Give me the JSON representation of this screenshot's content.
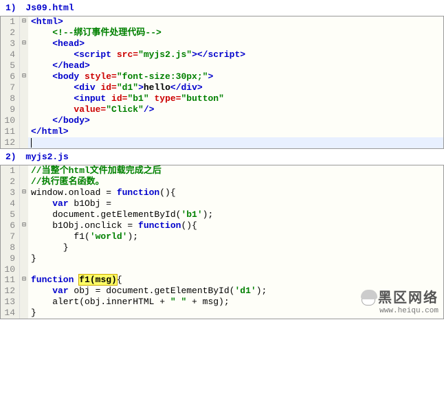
{
  "file1": {
    "num": "1)",
    "name": "Js09.html"
  },
  "file2": {
    "num": "2)",
    "name": "myjs2.js"
  },
  "editor1": {
    "lines": [
      {
        "n": "1",
        "fold": "⊟",
        "tokens": [
          [
            "t-tag",
            "<html>"
          ]
        ]
      },
      {
        "n": "2",
        "fold": "",
        "tokens": [
          [
            "t-plain",
            "    "
          ],
          [
            "t-comment",
            "<!--绑订事件处理代码-->"
          ]
        ]
      },
      {
        "n": "3",
        "fold": "⊟",
        "tokens": [
          [
            "t-plain",
            "    "
          ],
          [
            "t-tag",
            "<head>"
          ]
        ]
      },
      {
        "n": "4",
        "fold": "",
        "tokens": [
          [
            "t-plain",
            "        "
          ],
          [
            "t-tag",
            "<script "
          ],
          [
            "t-attr",
            "src="
          ],
          [
            "t-str",
            "\"myjs2.js\""
          ],
          [
            "t-tag",
            "></script"
          ],
          [
            "t-tag",
            ">"
          ]
        ]
      },
      {
        "n": "5",
        "fold": "",
        "tokens": [
          [
            "t-plain",
            "    "
          ],
          [
            "t-tag",
            "</head>"
          ]
        ]
      },
      {
        "n": "6",
        "fold": "⊟",
        "tokens": [
          [
            "t-plain",
            "    "
          ],
          [
            "t-tag",
            "<body "
          ],
          [
            "t-attr",
            "style="
          ],
          [
            "t-str",
            "\"font-size:30px;\""
          ],
          [
            "t-tag",
            ">"
          ]
        ]
      },
      {
        "n": "7",
        "fold": "",
        "tokens": [
          [
            "t-plain",
            "        "
          ],
          [
            "t-tag",
            "<div "
          ],
          [
            "t-attr",
            "id="
          ],
          [
            "t-str",
            "\"d1\""
          ],
          [
            "t-tag",
            ">"
          ],
          [
            "t-text",
            "hello"
          ],
          [
            "t-tag",
            "</div>"
          ]
        ]
      },
      {
        "n": "8",
        "fold": "",
        "tokens": [
          [
            "t-plain",
            "        "
          ],
          [
            "t-tag",
            "<input "
          ],
          [
            "t-attr",
            "id="
          ],
          [
            "t-str",
            "\"b1\""
          ],
          [
            "t-tag",
            " "
          ],
          [
            "t-attr",
            "type="
          ],
          [
            "t-str",
            "\"button\""
          ]
        ]
      },
      {
        "n": "9",
        "fold": "",
        "tokens": [
          [
            "t-plain",
            "        "
          ],
          [
            "t-attr",
            "value="
          ],
          [
            "t-str",
            "\"Click\""
          ],
          [
            "t-tag",
            "/>"
          ]
        ]
      },
      {
        "n": "10",
        "fold": "",
        "tokens": [
          [
            "t-plain",
            "    "
          ],
          [
            "t-tag",
            "</body>"
          ]
        ]
      },
      {
        "n": "11",
        "fold": "",
        "tokens": [
          [
            "t-tag",
            "</html>"
          ]
        ]
      },
      {
        "n": "12",
        "fold": "",
        "cursor": true,
        "tokens": []
      }
    ]
  },
  "editor2": {
    "lines": [
      {
        "n": "1",
        "fold": "",
        "tokens": [
          [
            "t-comment",
            "//当整个html文件加载完成之后"
          ]
        ]
      },
      {
        "n": "2",
        "fold": "",
        "tokens": [
          [
            "t-comment",
            "//执行匿名函数。"
          ]
        ]
      },
      {
        "n": "3",
        "fold": "⊟",
        "tokens": [
          [
            "t-plain",
            "window.onload = "
          ],
          [
            "t-kw",
            "function"
          ],
          [
            "t-plain",
            "(){"
          ]
        ]
      },
      {
        "n": "4",
        "fold": "",
        "tokens": [
          [
            "t-plain",
            "    "
          ],
          [
            "t-kw",
            "var"
          ],
          [
            "t-plain",
            " b1Obj ="
          ]
        ]
      },
      {
        "n": "5",
        "fold": "",
        "tokens": [
          [
            "t-plain",
            "    document.getElementById("
          ],
          [
            "t-str",
            "'b1'"
          ],
          [
            "t-plain",
            ");"
          ]
        ]
      },
      {
        "n": "6",
        "fold": "⊟",
        "tokens": [
          [
            "t-plain",
            "    b1Obj.onclick = "
          ],
          [
            "t-kw",
            "function"
          ],
          [
            "t-plain",
            "(){"
          ]
        ]
      },
      {
        "n": "7",
        "fold": "",
        "tokens": [
          [
            "t-plain",
            "        f1("
          ],
          [
            "t-str",
            "'world'"
          ],
          [
            "t-plain",
            ");"
          ]
        ]
      },
      {
        "n": "8",
        "fold": "",
        "tokens": [
          [
            "t-plain",
            "      }"
          ]
        ]
      },
      {
        "n": "9",
        "fold": "",
        "tokens": [
          [
            "t-plain",
            "}"
          ]
        ]
      },
      {
        "n": "10",
        "fold": "",
        "tokens": []
      },
      {
        "n": "11",
        "fold": "⊟",
        "tokens": [
          [
            "t-kw",
            "function"
          ],
          [
            "t-plain",
            " "
          ],
          [
            "t-hl",
            "f1(msg)"
          ],
          [
            "t-plain",
            "{"
          ]
        ]
      },
      {
        "n": "12",
        "fold": "",
        "tokens": [
          [
            "t-plain",
            "    "
          ],
          [
            "t-kw",
            "var"
          ],
          [
            "t-plain",
            " obj = document.getElementById("
          ],
          [
            "t-str",
            "'d1'"
          ],
          [
            "t-plain",
            ");"
          ]
        ]
      },
      {
        "n": "13",
        "fold": "",
        "tokens": [
          [
            "t-plain",
            "    alert(obj.innerHTML + "
          ],
          [
            "t-str",
            "\" \""
          ],
          [
            "t-plain",
            " + msg);"
          ]
        ]
      },
      {
        "n": "14",
        "fold": "",
        "tokens": [
          [
            "t-plain",
            "}"
          ]
        ]
      }
    ]
  },
  "watermark": {
    "big": "黑区网络",
    "small": "www.heiqu.com"
  }
}
